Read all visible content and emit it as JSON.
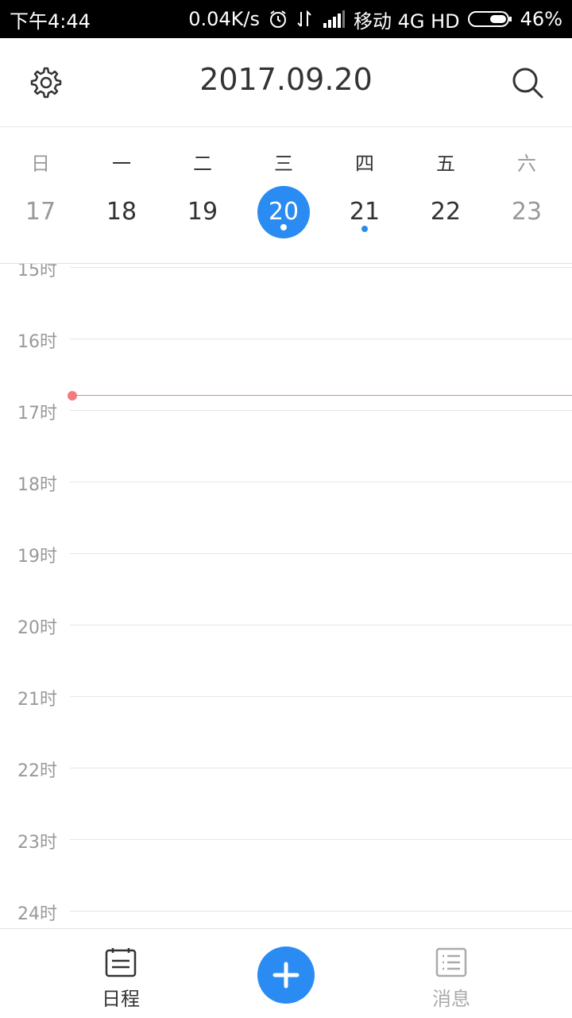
{
  "status_bar": {
    "time": "下午4:44",
    "net_speed": "0.04K/s",
    "carrier": "移动 4G HD",
    "battery": "46%",
    "icons": [
      "alarm-icon",
      "data-transfer-icon",
      "signal-icon",
      "battery-icon"
    ]
  },
  "header": {
    "title": "2017.09.20",
    "icons": [
      "gear-icon",
      "search-icon"
    ]
  },
  "week": {
    "days": [
      {
        "label": "日",
        "date": "17",
        "weekend": true,
        "selected": false,
        "has_event": false
      },
      {
        "label": "一",
        "date": "18",
        "weekend": false,
        "selected": false,
        "has_event": false
      },
      {
        "label": "二",
        "date": "19",
        "weekend": false,
        "selected": false,
        "has_event": false
      },
      {
        "label": "三",
        "date": "20",
        "weekend": false,
        "selected": true,
        "has_event": true
      },
      {
        "label": "四",
        "date": "21",
        "weekend": false,
        "selected": false,
        "has_event": true
      },
      {
        "label": "五",
        "date": "22",
        "weekend": false,
        "selected": false,
        "has_event": false
      },
      {
        "label": "六",
        "date": "23",
        "weekend": true,
        "selected": false,
        "has_event": false
      }
    ]
  },
  "timeline": {
    "hours": [
      "15时",
      "16时",
      "17时",
      "18时",
      "19时",
      "20时",
      "21时",
      "22时",
      "23时",
      "24时"
    ]
  },
  "bottom_nav": {
    "schedule_label": "日程",
    "messages_label": "消息"
  },
  "colors": {
    "accent": "#2a8cf2",
    "now_indicator": "#f47b7b",
    "muted_text": "#999999"
  }
}
